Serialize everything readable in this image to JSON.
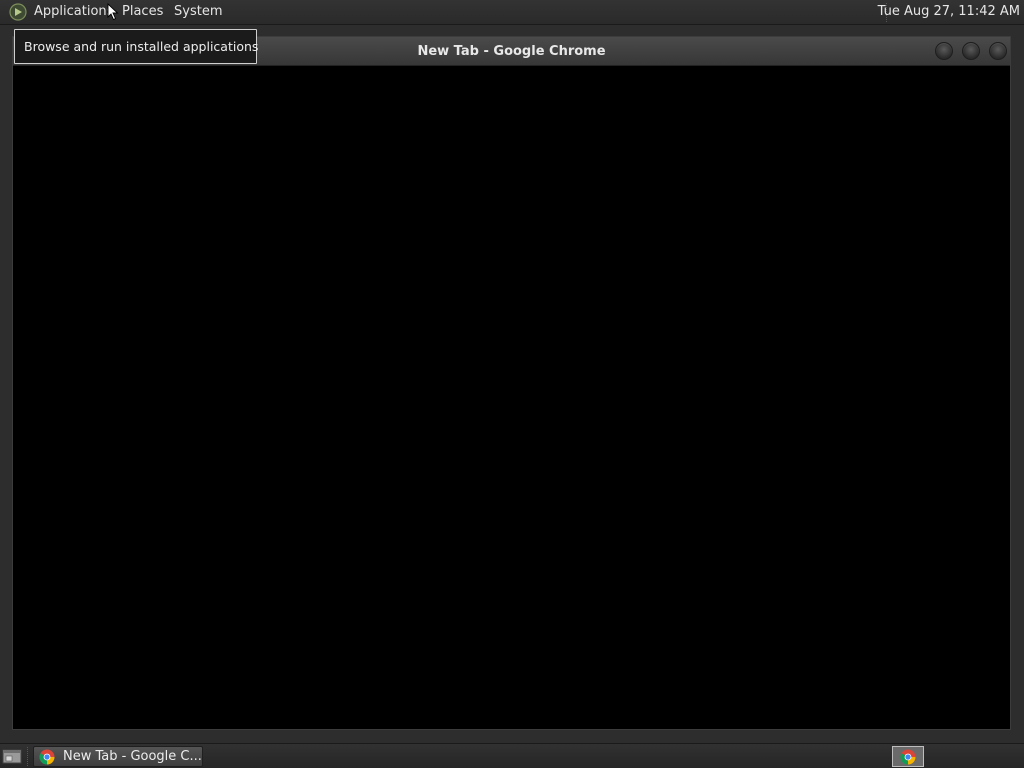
{
  "top_panel": {
    "menus": [
      {
        "label": "Applications"
      },
      {
        "label": "Places"
      },
      {
        "label": "System"
      }
    ],
    "clock": "Tue Aug 27, 11:42 AM"
  },
  "tooltip": {
    "text": "Browse and run installed applications"
  },
  "window": {
    "title": "New Tab - Google Chrome"
  },
  "taskbar": {
    "task_label": "New Tab - Google C..."
  },
  "icons": {
    "menu_logo": "gnome-foot-icon",
    "show_desktop": "show-desktop-icon",
    "chrome": "chrome-icon"
  },
  "colors": {
    "panel_bg": "#2d2d2d",
    "window_content": "#000000",
    "text": "#e6e6e6"
  }
}
